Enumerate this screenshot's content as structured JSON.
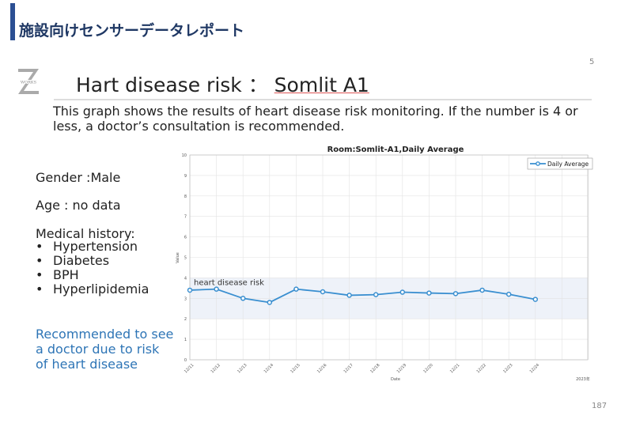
{
  "header": {
    "title": "施設向けセンサーデータレポート",
    "page_number": "5",
    "footer_number": "187"
  },
  "logo": {
    "text": "Z WORKS"
  },
  "slide": {
    "title_prefix": "Hart disease risk  ：",
    "title_room": "Somlit A1",
    "description": "This graph shows the results of heart disease risk monitoring. If the number is 4 or less, a doctor’s consultation is recommended."
  },
  "profile": {
    "gender": "Gender :Male",
    "age": "Age : no data",
    "history_label": "Medical history:",
    "history": [
      "Hypertension",
      "Diabetes",
      "BPH",
      "Hyperlipidemia"
    ],
    "recommendation": "Recommended to see a doctor due to risk of heart disease"
  },
  "colors": {
    "accent": "#2b4f93",
    "line": "#3a8fd0",
    "band": "#eef2f9",
    "recommend": "#2e75b6"
  },
  "chart_data": {
    "type": "line",
    "title": "Room:Somlit-A1,Daily Average",
    "xlabel": "Date",
    "ylabel": "Value",
    "x_note": "2023年",
    "categories": [
      "12/11",
      "12/12",
      "12/13",
      "12/14",
      "12/15",
      "12/16",
      "12/17",
      "12/18",
      "12/19",
      "12/20",
      "12/21",
      "12/22",
      "12/23",
      "12/24"
    ],
    "series": [
      {
        "name": "Daily Average",
        "values": [
          3.4,
          3.45,
          3.0,
          2.8,
          3.45,
          3.32,
          3.15,
          3.18,
          3.3,
          3.26,
          3.23,
          3.4,
          3.2,
          2.95
        ]
      }
    ],
    "ylim": [
      0,
      10
    ],
    "yticks": [
      0,
      1,
      2,
      3,
      4,
      5,
      6,
      7,
      8,
      9,
      10
    ],
    "band": {
      "from": 2,
      "to": 4,
      "label": "heart disease risk"
    },
    "grid": true,
    "legend": "top-right"
  }
}
